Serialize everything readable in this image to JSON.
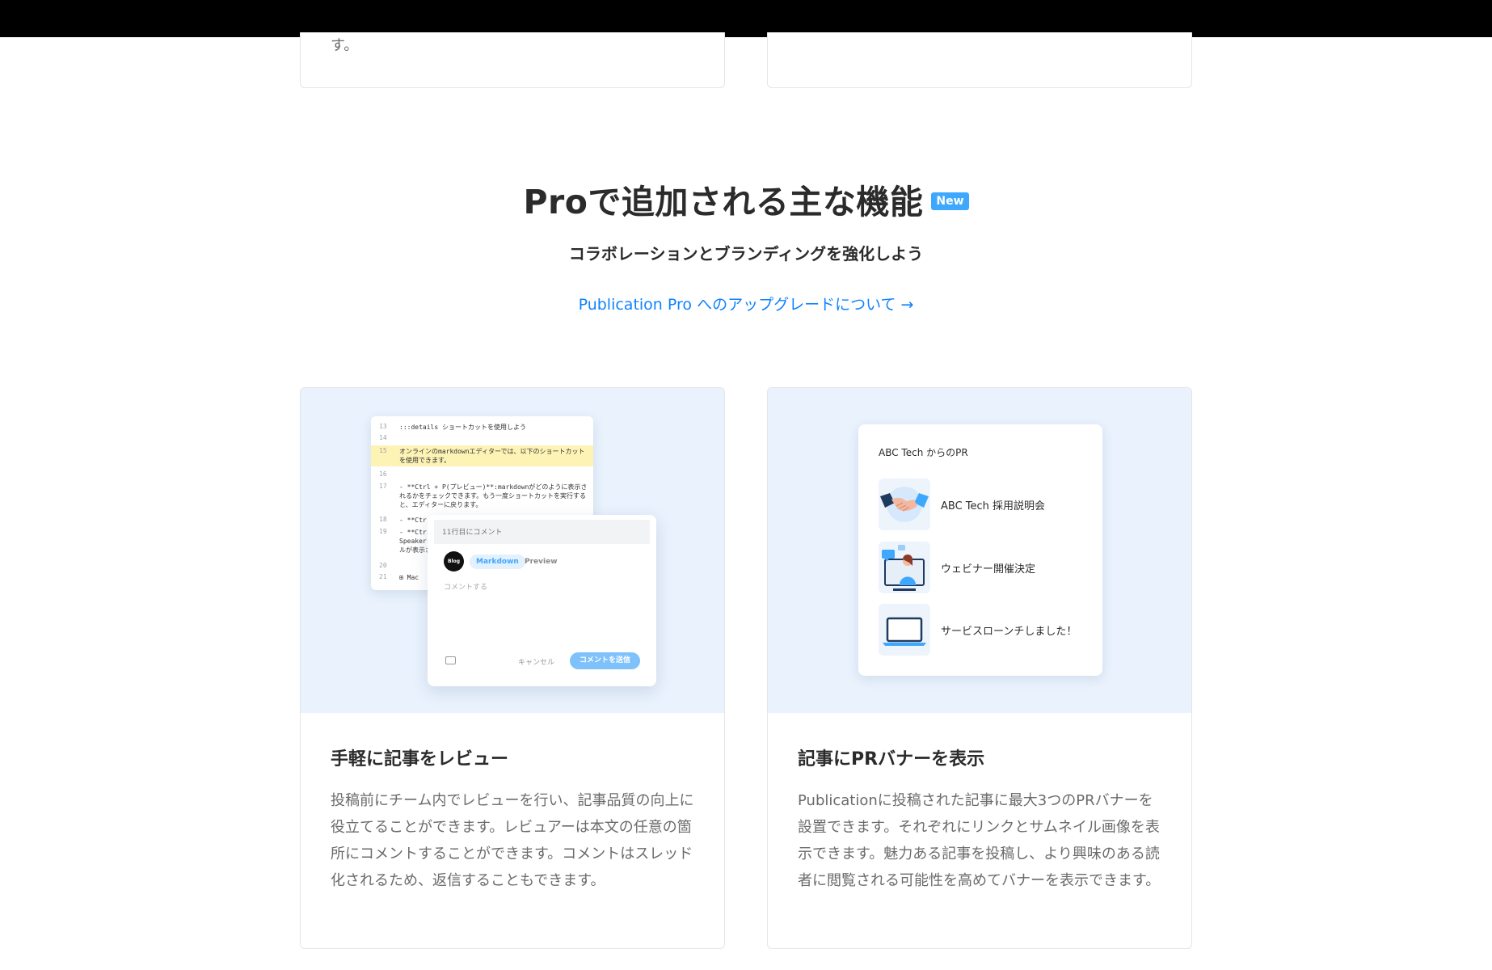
{
  "previous_section": {
    "left_card_tail": "す。"
  },
  "pro_section": {
    "heading": "Proで追加される主な機能",
    "badge": "New",
    "subheading": "コラボレーションとブランディングを強化しよう",
    "upgrade_link": "Publication Pro へのアップグレードについて",
    "upgrade_arrow": "→"
  },
  "features": [
    {
      "title": "手軽に記事をレビュー",
      "description": "投稿前にチーム内でレビューを行い、記事品質の向上に役立てることができます。レビュアーは本文の任意の箇所にコメントすることができます。コメントはスレッド化されるため、返信することもできます。",
      "illustration": {
        "editor_lines": [
          {
            "no": "13",
            "text": ":::details ショートカットを使用しよう"
          },
          {
            "no": "14",
            "text": ""
          },
          {
            "no": "15",
            "text": "オンラインのmarkdownエディターでは、以下のショートカットを使用できます。"
          },
          {
            "no": "16",
            "text": ""
          },
          {
            "no": "17",
            "text": "- **Ctrl + P(プレビュー)**:markdownがどのように表示されるかをチェックできます。もう一度ショートカットを実行すると、エディターに戻ります。"
          },
          {
            "no": "18",
            "text": "- **Ctr"
          },
          {
            "no": "19",
            "text": "- **Ctr Speaker ルが表示さ"
          },
          {
            "no": "20",
            "text": ""
          },
          {
            "no": "21",
            "text": "⊞ Mac"
          }
        ],
        "comment_header": "11行目にコメント",
        "avatar_text": "Blog",
        "tab_markdown": "Markdown",
        "tab_preview": "Preview",
        "comment_placeholder": "コメントする",
        "cancel_label": "キャンセル",
        "send_label": "コメントを送信",
        "image_icon": "image-icon"
      }
    },
    {
      "title": "記事にPRバナーを表示",
      "description": "Publicationに投稿された記事に最大3つのPRバナーを設置できます。それぞれにリンクとサムネイル画像を表示できます。魅力ある記事を投稿し、より興味のある読者に閲覧される可能性を高めてバナーを表示できます。",
      "illustration": {
        "panel_title": "ABC Tech からのPR",
        "items": [
          {
            "label": "ABC Tech 採用説明会",
            "icon": "handshake-icon"
          },
          {
            "label": "ウェビナー開催決定",
            "icon": "webinar-icon"
          },
          {
            "label": "サービスローンチしました！",
            "icon": "laptop-icon"
          }
        ]
      }
    }
  ]
}
